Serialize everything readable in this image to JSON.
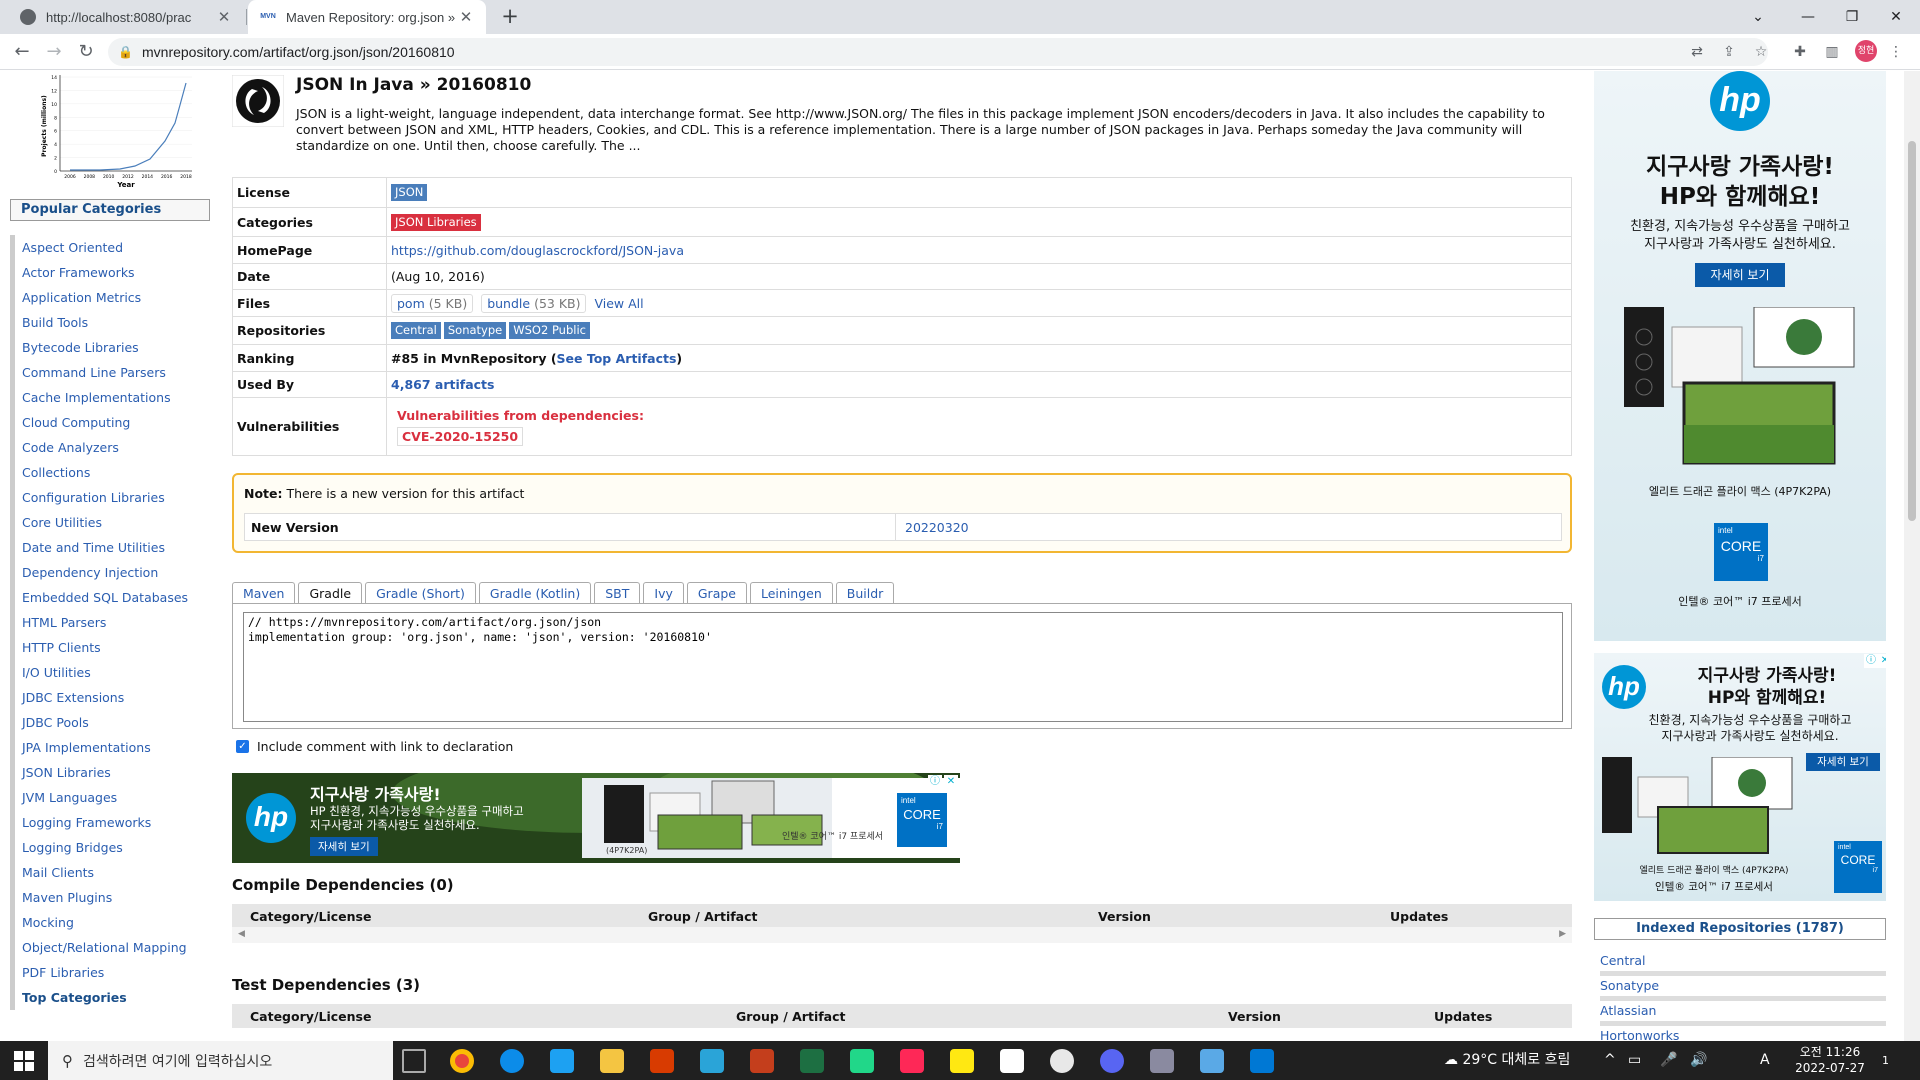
{
  "browser": {
    "tabs": [
      {
        "title": "http://localhost:8080/prac",
        "active": false
      },
      {
        "title": "Maven Repository: org.json » js",
        "active": true
      }
    ],
    "url": "mvnrepository.com/artifact/org.json/json/20160810",
    "profile_initials": "정현"
  },
  "chart": {
    "ylabel": "Projects (millions)",
    "xlabel": "Year",
    "years": [
      "2006",
      "2008",
      "2010",
      "2012",
      "2014",
      "2016",
      "2018"
    ],
    "yticks": [
      "14",
      "12",
      "10",
      "8",
      "6",
      "4",
      "2",
      "0"
    ]
  },
  "sidebar": {
    "header": "Popular Categories",
    "categories": [
      "Aspect Oriented",
      "Actor Frameworks",
      "Application Metrics",
      "Build Tools",
      "Bytecode Libraries",
      "Command Line Parsers",
      "Cache Implementations",
      "Cloud Computing",
      "Code Analyzers",
      "Collections",
      "Configuration Libraries",
      "Core Utilities",
      "Date and Time Utilities",
      "Dependency Injection",
      "Embedded SQL Databases",
      "HTML Parsers",
      "HTTP Clients",
      "I/O Utilities",
      "JDBC Extensions",
      "JDBC Pools",
      "JPA Implementations",
      "JSON Libraries",
      "JVM Languages",
      "Logging Frameworks",
      "Logging Bridges",
      "Mail Clients",
      "Maven Plugins",
      "Mocking",
      "Object/Relational Mapping",
      "PDF Libraries"
    ],
    "top_link": "Top Categories"
  },
  "artifact": {
    "title": "JSON In Java » 20160810",
    "description": "JSON is a light-weight, language independent, data interchange format. See http://www.JSON.org/ The files in this package implement JSON encoders/decoders in Java. It also includes the capability to convert between JSON and XML, HTTP headers, Cookies, and CDL. This is a reference implementation. There is a large number of JSON packages in Java. Perhaps someday the Java community will standardize on one. Until then, choose carefully. The ...",
    "labels": {
      "license": "License",
      "categories": "Categories",
      "homepage": "HomePage",
      "date": "Date",
      "files": "Files",
      "repositories": "Repositories",
      "ranking": "Ranking",
      "used_by": "Used By",
      "vulnerabilities": "Vulnerabilities"
    },
    "license": "JSON",
    "category": "JSON Libraries",
    "homepage": "https://github.com/douglascrockford/JSON-java",
    "date": "(Aug 10, 2016)",
    "files": {
      "pom": "pom",
      "pom_size": "(5 KB)",
      "bundle": "bundle",
      "bundle_size": "(53 KB)",
      "view_all": "View All"
    },
    "repositories": [
      "Central",
      "Sonatype",
      "WSO2 Public"
    ],
    "ranking_text": "#85 in MvnRepository (",
    "ranking_link": "See Top Artifacts",
    "ranking_close": ")",
    "used_by": "4,867 artifacts",
    "vuln_title": "Vulnerabilities from dependencies:",
    "cve": "CVE-2020-15250"
  },
  "note": {
    "label": "Note:",
    "text": " There is a new version for this artifact",
    "new_version_label": "New Version",
    "new_version": "20220320"
  },
  "build_tabs": [
    "Maven",
    "Gradle",
    "Gradle (Short)",
    "Gradle (Kotlin)",
    "SBT",
    "Ivy",
    "Grape",
    "Leiningen",
    "Buildr"
  ],
  "active_build_tab": "Gradle",
  "snippet": "// https://mvnrepository.com/artifact/org.json/json\nimplementation group: 'org.json', name: 'json', version: '20160810'",
  "include_comment": "Include comment with link to declaration",
  "ad_banner": {
    "headline": "지구사랑 가족사랑!",
    "line1": "HP 친환경, 지속가능성 우수상품을 구매하고",
    "line2": "지구사랑과 가족사랑도 실천하세요.",
    "button": "자세히 보기",
    "model": "(4P7K2PA)",
    "cpu": "인텔® 코어™ i7 프로세서",
    "intel": "intel",
    "core": "CORE",
    "i7": "i7",
    "hp": "hp"
  },
  "compile_deps": {
    "title": "Compile Dependencies (0)",
    "cols": [
      "Category/License",
      "Group / Artifact",
      "Version",
      "Updates"
    ]
  },
  "test_deps": {
    "title": "Test Dependencies (3)",
    "cols": [
      "Category/License",
      "Group / Artifact",
      "Version",
      "Updates"
    ]
  },
  "right_ad1": {
    "hp": "hp",
    "headline1": "지구사랑 가족사랑!",
    "headline2": "HP와 함께해요!",
    "sub1": "친환경, 지속가능성 우수상품을 구매하고",
    "sub2": "지구사랑과 가족사랑도 실천하세요.",
    "button": "자세히 보기",
    "product": "엘리트 드래곤 플라이 맥스 (4P7K2PA)",
    "intel": "intel",
    "core": "CORE",
    "i7": "i7",
    "cpu": "인텔® 코어™ i7 프로세서"
  },
  "right_ad2": {
    "hp": "hp",
    "headline1": "지구사랑 가족사랑!",
    "headline2": "HP와 함께해요!",
    "sub1": "친환경, 지속가능성 우수상품을 구매하고",
    "sub2": "지구사랑과 가족사랑도 실천하세요.",
    "button": "자세히 보기",
    "product": "엘리트 드래곤 플라이 맥스 (4P7K2PA)",
    "intel": "intel",
    "core": "CORE",
    "i7": "i7",
    "cpu": "인텔® 코어™ i7 프로세서"
  },
  "indexed": {
    "header": "Indexed Repositories (1787)",
    "items": [
      "Central",
      "Sonatype",
      "Atlassian",
      "Hortonworks"
    ]
  },
  "taskbar": {
    "search_placeholder": "검색하려면 여기에 입력하십시오",
    "weather": "29°C  대체로 흐림",
    "time": "오전 11:26",
    "date": "2022-07-27",
    "ime": "A",
    "notif": "1"
  }
}
